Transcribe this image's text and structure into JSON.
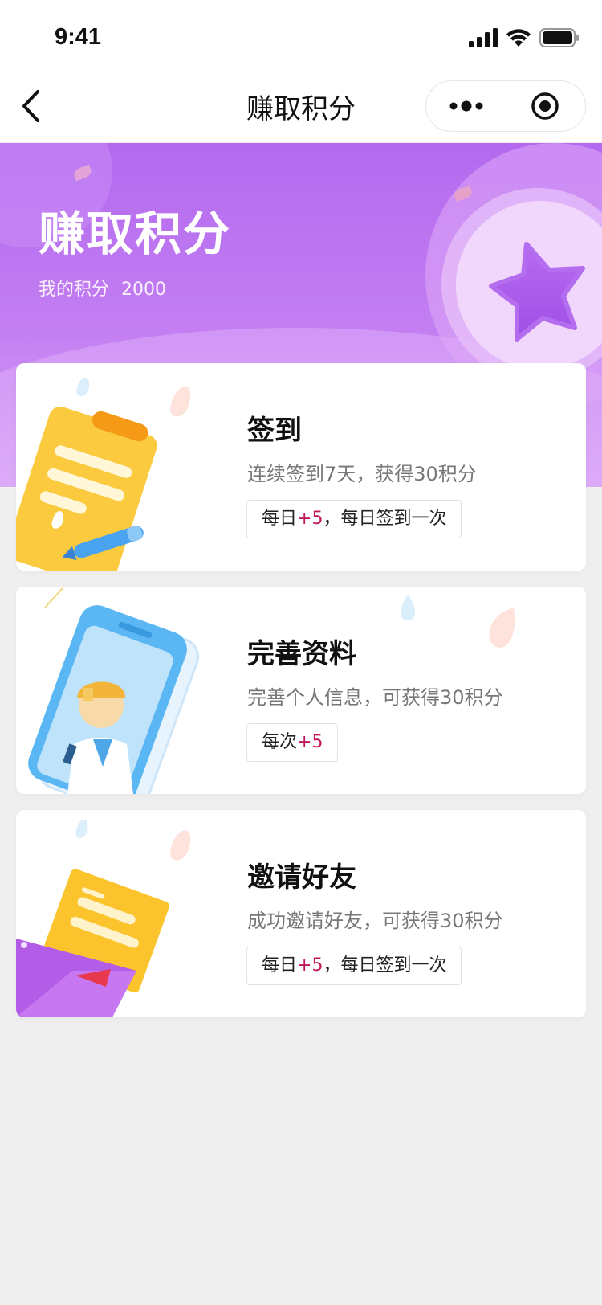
{
  "status_bar": {
    "time": "9:41"
  },
  "nav": {
    "title": "赚取积分"
  },
  "banner": {
    "title": "赚取积分",
    "points_label": "我的积分",
    "points_value": "2000"
  },
  "cards": [
    {
      "title": "签到",
      "desc": "连续签到7天，获得30积分",
      "tag_prefix": "每日",
      "tag_plus": "+5",
      "tag_suffix": "，每日签到一次",
      "illustration": "clipboard-icon"
    },
    {
      "title": "完善资料",
      "desc": "完善个人信息，可获得30积分",
      "tag_prefix": "每次",
      "tag_plus": "+5",
      "tag_suffix": "",
      "illustration": "phone-profile-icon"
    },
    {
      "title": "邀请好友",
      "desc": "成功邀请好友，可获得30积分",
      "tag_prefix": "每日",
      "tag_plus": "+5",
      "tag_suffix": "，每日签到一次",
      "illustration": "envelope-invite-icon"
    }
  ],
  "colors": {
    "banner_gradient_top": "#b469ef",
    "banner_gradient_bottom": "#d8a4f6",
    "plus_accent": "#c2185b",
    "page_background": "#efefef"
  }
}
